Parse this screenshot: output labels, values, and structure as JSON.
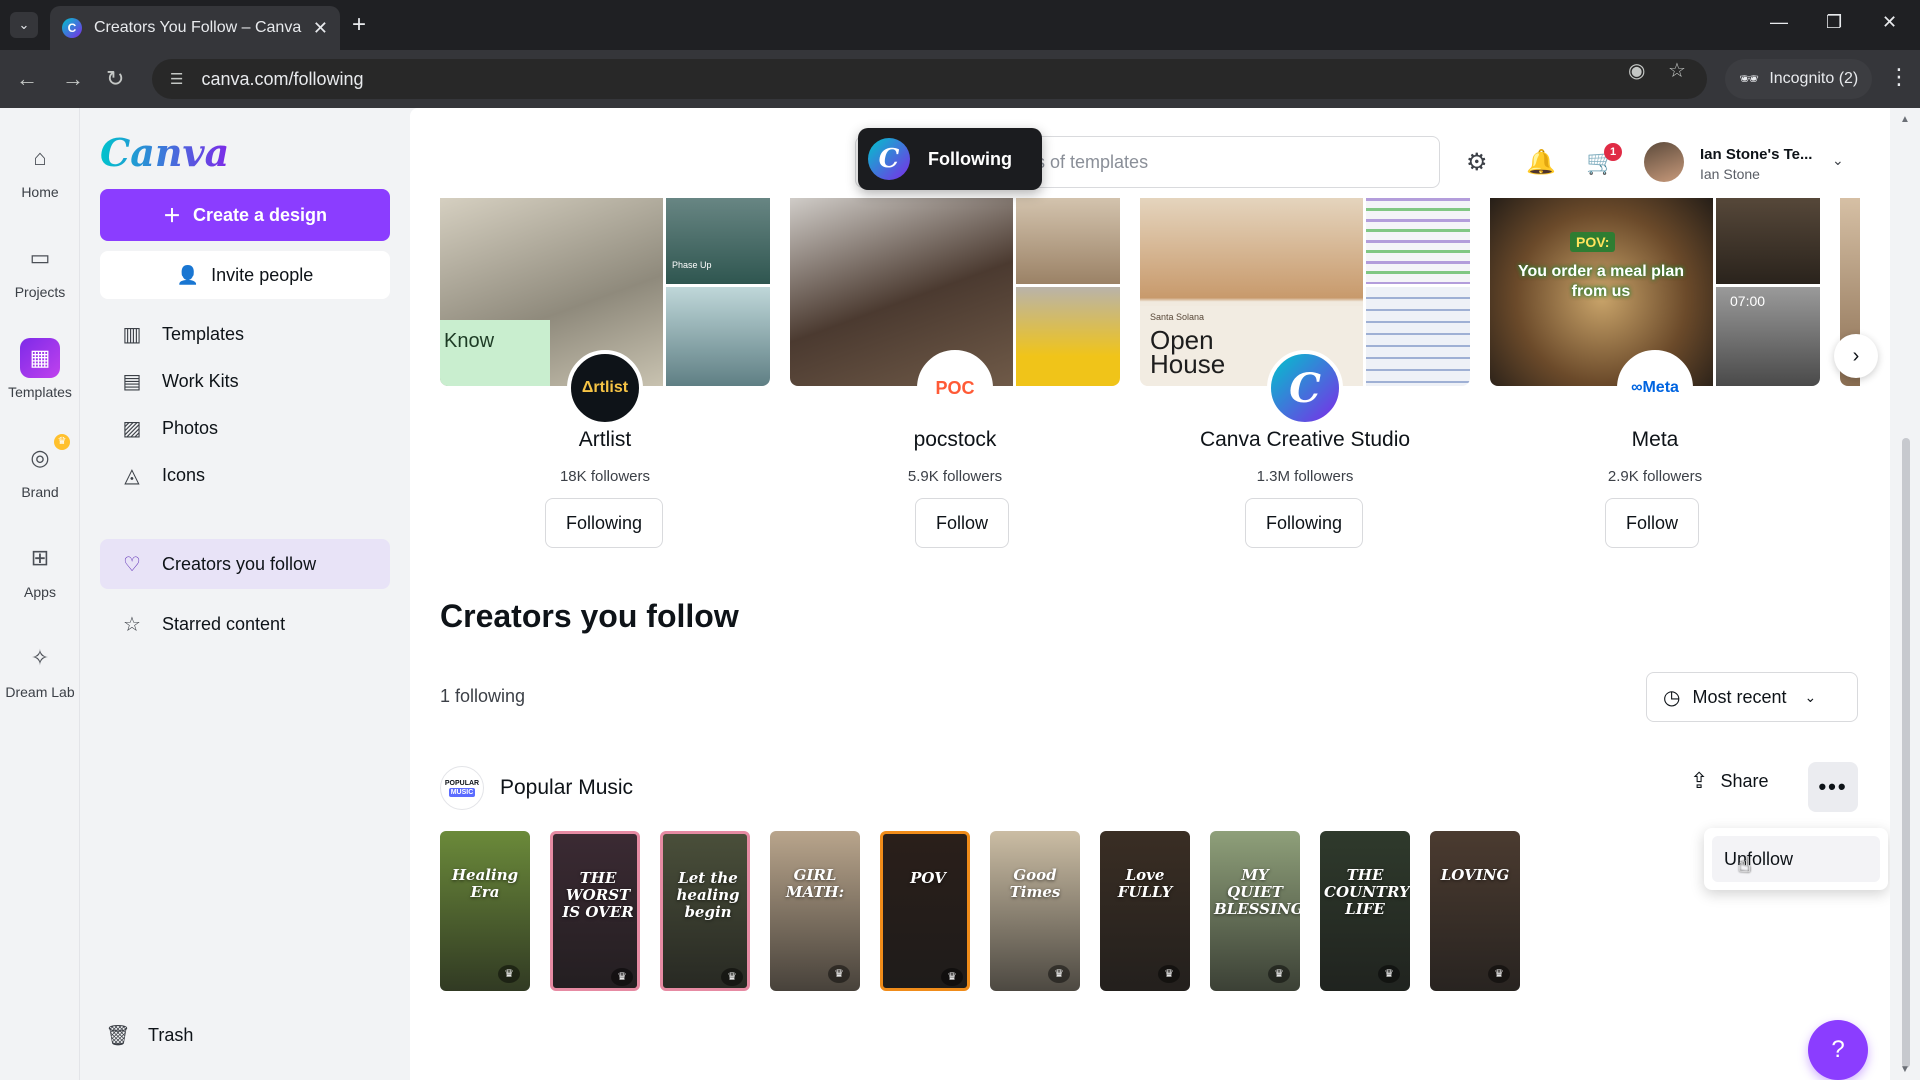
{
  "browser": {
    "tab_title": "Creators You Follow – Canva",
    "url": "canva.com/following",
    "incognito_label": "Incognito (2)"
  },
  "rail": [
    {
      "label": "Home",
      "icon": "home-icon"
    },
    {
      "label": "Projects",
      "icon": "folder-icon"
    },
    {
      "label": "Templates",
      "icon": "templates-icon"
    },
    {
      "label": "Brand",
      "icon": "brand-icon"
    },
    {
      "label": "Apps",
      "icon": "apps-icon"
    },
    {
      "label": "Dream Lab",
      "icon": "dream-lab-icon"
    }
  ],
  "sidebar": {
    "logo": "Canva",
    "create_label": "Create a design",
    "invite_label": "Invite people",
    "items": [
      {
        "label": "Templates",
        "icon": "layout-icon"
      },
      {
        "label": "Work Kits",
        "icon": "briefcase-icon"
      },
      {
        "label": "Photos",
        "icon": "image-icon"
      },
      {
        "label": "Icons",
        "icon": "shapes-icon"
      },
      {
        "label": "Creators you follow",
        "icon": "heart-icon"
      },
      {
        "label": "Starred content",
        "icon": "star-icon"
      }
    ],
    "trash_label": "Trash"
  },
  "topbar": {
    "search_placeholder": "ds of templates",
    "toast_label": "Following",
    "cart_count": "1",
    "account_team": "Ian Stone's Te...",
    "account_name": "Ian Stone"
  },
  "creators": [
    {
      "name": "Artlist",
      "followers": "18K followers",
      "button": "Following",
      "avatar_text": "Δrtlist"
    },
    {
      "name": "pocstock",
      "followers": "5.9K followers",
      "button": "Follow",
      "avatar_text": "POC"
    },
    {
      "name": "Canva Creative Studio",
      "followers": "1.3M followers",
      "button": "Following",
      "avatar_text": "C"
    },
    {
      "name": "Meta",
      "followers": "2.9K followers",
      "button": "Follow",
      "avatar_text": "∞Meta"
    }
  ],
  "card_texts": {
    "artlist_side": "Phase Up",
    "artlist_main": "Know",
    "ccs_main": "Open House",
    "ccs_small": "Santa Solana",
    "meta_pov": "POV:",
    "meta_main": "You order a meal plan from us",
    "meta_time": "07:00"
  },
  "section": {
    "title": "Creators you follow",
    "following_count": "1 following",
    "sort_label": "Most recent"
  },
  "creator_row": {
    "name": "Popular Music",
    "logo_line1": "POPULAR",
    "logo_line2": "MUSIC",
    "share_label": "Share",
    "menu_item": "Unfollow"
  },
  "thumbnails": [
    {
      "text": "Healing Era",
      "bg": "#6b8a3a",
      "border": ""
    },
    {
      "text": "THE WORST IS OVER",
      "bg": "#3b2a33",
      "border": "#e68ba3"
    },
    {
      "text": "Let the healing begin",
      "bg": "#4a4f3a",
      "border": "#e68ba3"
    },
    {
      "text": "GIRL MATH:",
      "bg": "#b9a58c",
      "border": ""
    },
    {
      "text": "POV",
      "bg": "#2a1f1a",
      "border": "#f08c1a"
    },
    {
      "text": "Good Times",
      "bg": "#cbbda4",
      "border": ""
    },
    {
      "text": "Love FULLY",
      "bg": "#3a2e24",
      "border": ""
    },
    {
      "text": "MY QUIET BLESSING",
      "bg": "#8fa07a",
      "border": ""
    },
    {
      "text": "THE COUNTRY LIFE",
      "bg": "#2f3a2c",
      "border": ""
    },
    {
      "text": "LOVING",
      "bg": "#4b3b30",
      "border": ""
    }
  ],
  "colors": {
    "accent": "#8b3dff",
    "brand_gradient_start": "#00c4cc",
    "brand_gradient_end": "#7d2ae8",
    "active_sidebar": "#e8e3f7"
  }
}
